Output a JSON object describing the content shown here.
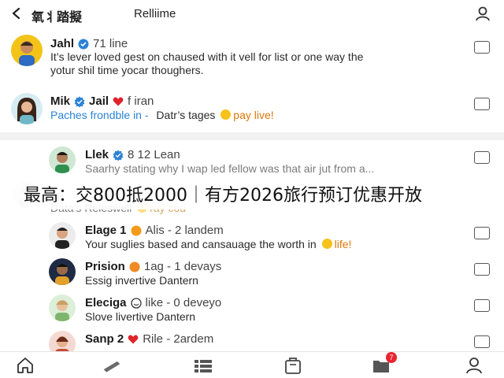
{
  "header": {
    "title": "氧丬踏擬",
    "subtitle": "Relliime"
  },
  "posts": [
    {
      "name": "Jahl",
      "meta": "71 line",
      "line1": "It’s lever loved gest on chaused with it vell for list or one way the",
      "line2": "yotur shil time yocar thoughers."
    },
    {
      "name": "Mik",
      "name2": "Jail",
      "meta": "f iran",
      "line1_a": "Paches frondble in -",
      "line1_b": "Datr’s tages",
      "line1_c": "pay live!"
    },
    {
      "name": "Llek",
      "meta": "8 12 Lean",
      "line1": "Saarhy stating why I wap led fellow was that air jut from a..."
    },
    {
      "name": "Ja",
      "line1_a": "Data’s Releswell",
      "line1_b": "ray cod"
    },
    {
      "name": "Elage 1",
      "meta": "Alis - 2 landem",
      "line1_a": "Your suglies based and cansauage the worth in",
      "line1_b": "life!"
    },
    {
      "name": "Prision",
      "meta": "1ag - 1 devays",
      "line1": "Essig invertive Dantern"
    },
    {
      "name": "Eleciga",
      "meta": "like - 0 deveyo",
      "line1": "Slove livertive Dantern"
    },
    {
      "name": "Sanp 2",
      "meta": "Rile - 2ardem"
    }
  ],
  "overlay": {
    "text": "最高：交800抵2000｜有方2026旅行预订优惠开放"
  },
  "tabbar": {
    "notification_count": "7"
  },
  "colors": {
    "accent_blue": "#2a83d6",
    "heart_red": "#e0232b",
    "badge_red": "#e8262f",
    "emoji_yellow": "#f7c11b"
  },
  "icons": [
    "back-arrow-icon",
    "user-profile-icon",
    "verified-badge-icon",
    "heart-icon",
    "reply-icon",
    "home-icon",
    "pencil-icon",
    "list-icon",
    "bag-icon",
    "folder-icon",
    "profile-icon"
  ]
}
